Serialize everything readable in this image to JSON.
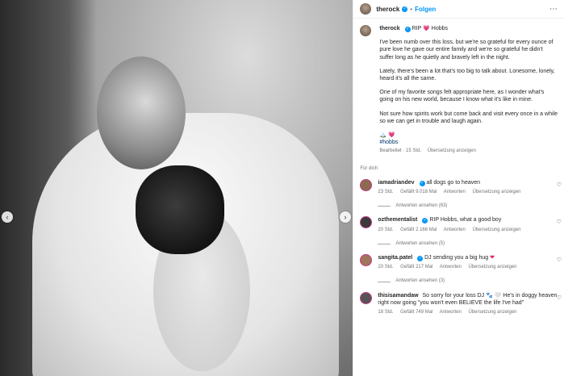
{
  "post": {
    "username": "therock",
    "follow_label": "Folgen"
  },
  "caption": {
    "username": "therock",
    "title": "RIP",
    "name": "Hobbs",
    "paragraphs": [
      "I've been numb over this loss, but we're so grateful for every ounce of pure love he gave our entire family and we're so grateful he didn't suffer long as he quietly and bravely left in the night.",
      "Lately, there's been a lot that's too big to talk about. Lonesome, lonely, heard it's all the same.",
      "One of my favorite songs felt appropriate here, as I wonder what's going on his new world, because I know what it's like in mine.",
      "Not sure how spirits work but come back and visit every once in a while so we can get in trouble and laugh again."
    ],
    "emoji_line": "🏔️ 💗",
    "hashtag": "#hobbs",
    "edited": "Bearbeitet · 15 Std.",
    "translate": "Übersetzung anzeigen"
  },
  "for_you": "Für dich",
  "comments": [
    {
      "user": "iamadriandev",
      "text": "all dogs go to heaven",
      "time": "23 Std.",
      "likes": "Gefällt 9.018 Mal",
      "reply": "Antworten",
      "translate": "Übersetzung anzeigen",
      "replies": "Antworten ansehen (63)",
      "avatar_color": "#8b6b4f"
    },
    {
      "user": "ozthementalist",
      "text": "RIP Hobbs, what a good boy",
      "time": "20 Std.",
      "likes": "Gefällt 2.166 Mal",
      "reply": "Antworten",
      "translate": "Übersetzung anzeigen",
      "replies": "Antworten ansehen (5)",
      "avatar_color": "#3a3a3a"
    },
    {
      "user": "sangita.patel",
      "text": "DJ sending you a big hug",
      "time": "20 Std.",
      "likes": "Gefällt 217 Mal",
      "reply": "Antworten",
      "translate": "Übersetzung anzeigen",
      "replies": "Antworten ansehen (3)",
      "avatar_color": "#a0765a"
    },
    {
      "user": "thisisamandaw",
      "text": "So sorry for your loss DJ 🐾 🤍 He's in doggy heaven right now going \"you won't even BELIEVE the life I've had\"",
      "time": "18 Std.",
      "likes": "Gefällt 749 Mal",
      "reply": "Antworten",
      "translate": "Übersetzung anzeigen",
      "avatar_color": "#555555"
    }
  ],
  "nav": {
    "prev": "‹",
    "next": "›"
  },
  "colors": {
    "accent": "#0095f6",
    "heart": "#e0245e"
  }
}
